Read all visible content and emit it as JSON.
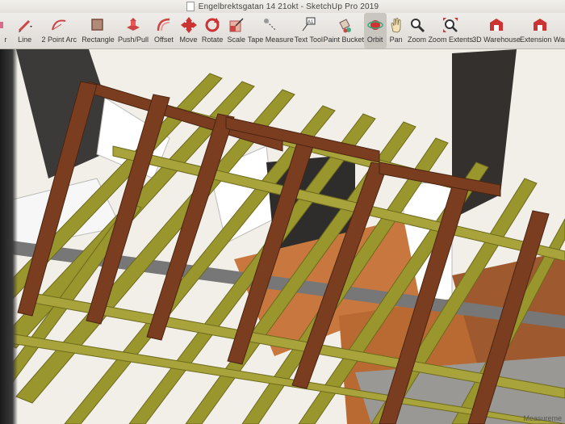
{
  "window": {
    "title": "Engelbrektsgatan 14 21okt - SketchUp Pro 2019"
  },
  "toolbar": {
    "tools": [
      {
        "label": "r",
        "icon": "eraser-icon"
      },
      {
        "label": "Line",
        "icon": "pencil-icon"
      },
      {
        "label": "2 Point Arc",
        "icon": "arc-icon"
      },
      {
        "label": "Rectangle",
        "icon": "rectangle-icon"
      },
      {
        "label": "Push/Pull",
        "icon": "push-pull-icon"
      },
      {
        "label": "Offset",
        "icon": "offset-icon"
      },
      {
        "label": "Move",
        "icon": "move-icon"
      },
      {
        "label": "Rotate",
        "icon": "rotate-icon"
      },
      {
        "label": "Scale",
        "icon": "scale-icon"
      },
      {
        "label": "Tape Measure",
        "icon": "tape-measure-icon"
      },
      {
        "label": "Text Tool",
        "icon": "text-tool-icon"
      },
      {
        "label": "Paint Bucket",
        "icon": "paint-bucket-icon"
      },
      {
        "label": "Orbit",
        "icon": "orbit-icon",
        "active": true
      },
      {
        "label": "Pan",
        "icon": "pan-icon"
      },
      {
        "label": "Zoom",
        "icon": "zoom-icon"
      },
      {
        "label": "Zoom Extents",
        "icon": "zoom-extents-icon"
      },
      {
        "label": "3D Warehouse",
        "icon": "warehouse-icon"
      },
      {
        "label": "Extension Ware",
        "icon": "extension-warehouse-icon"
      }
    ]
  },
  "status": {
    "measurement": "Measureme"
  },
  "colors": {
    "rafter": "#7a3d20",
    "joist": "#8a8a2a",
    "floor": "#c46a30",
    "sky": "#f4f1ea"
  }
}
